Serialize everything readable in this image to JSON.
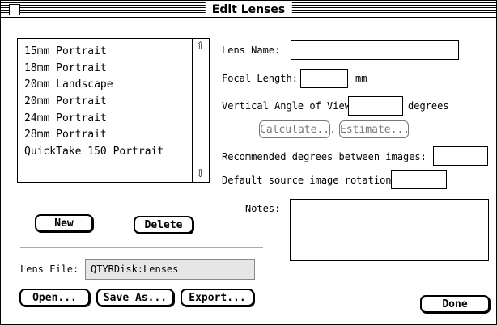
{
  "window": {
    "title": "Edit Lenses"
  },
  "lens_list": {
    "items": [
      "15mm Portrait",
      "18mm Portrait",
      "20mm Landscape",
      "20mm Portrait",
      "24mm Portrait",
      "28mm Portrait",
      "QuickTake 150 Portrait"
    ]
  },
  "fields": {
    "lens_name_label": "Lens Name:",
    "focal_length_label": "Focal Length:",
    "focal_length_unit": "mm",
    "vertical_angle_label": "Vertical Angle of View:",
    "vertical_angle_unit": "degrees",
    "recommended_label": "Recommended degrees between images:",
    "rotation_label": "Default source image rotation:",
    "notes_label": "Notes:",
    "lens_file_label": "Lens File:",
    "lens_file_value": "QTYRDisk:Lenses"
  },
  "buttons": {
    "calculate": "Calculate...",
    "estimate": "Estimate...",
    "new": "New",
    "delete": "Delete",
    "open": "Open...",
    "save_as": "Save As...",
    "export": "Export...",
    "done": "Done"
  }
}
